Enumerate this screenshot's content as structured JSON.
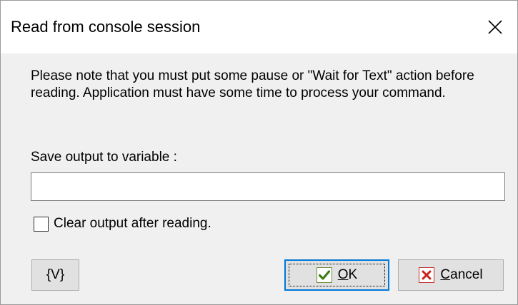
{
  "window": {
    "title": "Read from console session"
  },
  "note": {
    "text": "Please note that you must put some pause or \"Wait for Text\" action before reading. Application must have some time to process your command."
  },
  "variable": {
    "label": "Save output to variable :",
    "value": ""
  },
  "clear_output": {
    "label": "Clear output after reading.",
    "checked": false
  },
  "buttons": {
    "var_label": "{V}",
    "ok_label": "OK",
    "cancel_label": "Cancel"
  },
  "icons": {
    "close": "close-icon",
    "ok": "checkmark-icon",
    "cancel": "x-mark-icon"
  },
  "colors": {
    "ok_check": "#3a7d16",
    "cancel_x": "#c8231b",
    "default_button_border": "#0078d7"
  }
}
